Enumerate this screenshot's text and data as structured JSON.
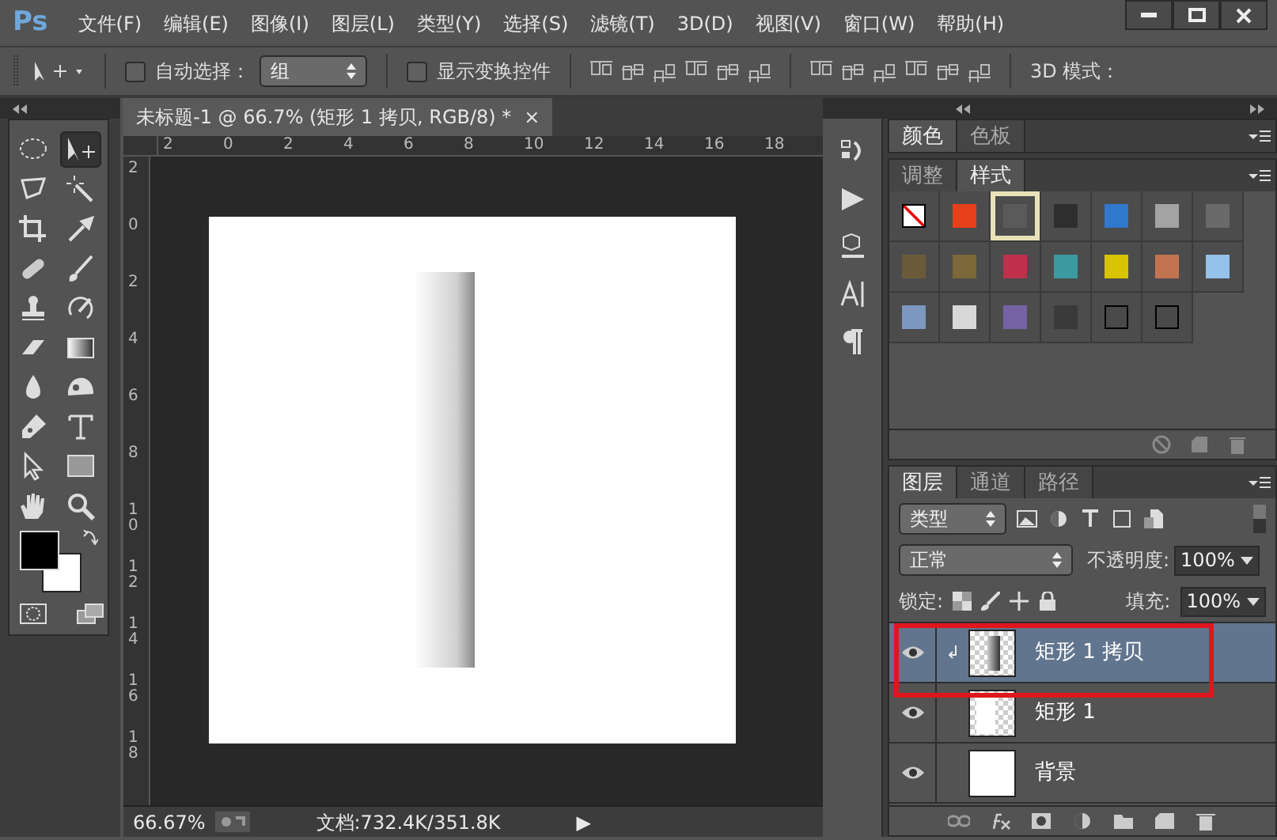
{
  "app": {
    "logo": "Ps"
  },
  "menu": [
    "文件(F)",
    "编辑(E)",
    "图像(I)",
    "图层(L)",
    "类型(Y)",
    "选择(S)",
    "滤镜(T)",
    "3D(D)",
    "视图(V)",
    "窗口(W)",
    "帮助(H)"
  ],
  "options_bar": {
    "auto_select": {
      "label": "自动选择：",
      "checked": false
    },
    "auto_select_target": "组",
    "show_transform": {
      "label": "显示变换控件",
      "checked": false
    },
    "mode_label": "3D 模式："
  },
  "toolbar": {
    "tools": [
      {
        "selected": false
      },
      {
        "selected": true
      },
      {
        "selected": false
      },
      {
        "selected": false
      },
      {
        "selected": false
      },
      {
        "selected": false
      },
      {
        "selected": false
      },
      {
        "selected": false
      },
      {
        "selected": false
      },
      {
        "selected": false
      },
      {
        "selected": false
      },
      {
        "selected": false
      },
      {
        "selected": false
      },
      {
        "selected": false
      },
      {
        "selected": false
      },
      {
        "selected": false
      },
      {
        "selected": false
      },
      {
        "selected": false
      },
      {
        "selected": false
      },
      {
        "selected": false
      }
    ]
  },
  "document_tab": {
    "title": "未标题-1 @ 66.7% (矩形 1 拷贝, RGB/8) *",
    "close": "×"
  },
  "rulers": {
    "horizontal": [
      "2",
      "0",
      "2",
      "4",
      "6",
      "8",
      "10",
      "12",
      "14",
      "16",
      "18"
    ],
    "vertical": [
      "2",
      "0",
      "2",
      "4",
      "6",
      "8",
      "10",
      "12",
      "14",
      "16",
      "18"
    ]
  },
  "status_bar": {
    "zoom": "66.67%",
    "doc_info": "文档:732.4K/351.8K",
    "menu_arrow": "▶"
  },
  "color_panel": {
    "tabs": [
      {
        "label": "颜色",
        "selected": true
      },
      {
        "label": "色板",
        "selected": false
      }
    ]
  },
  "styles_panel": {
    "tabs": [
      {
        "label": "调整",
        "selected": false
      },
      {
        "label": "样式",
        "selected": true
      }
    ],
    "swatches": [
      {
        "kind": "none",
        "color": "#ffffff",
        "selected": false
      },
      {
        "kind": "fill",
        "color": "#e8401a",
        "selected": false
      },
      {
        "kind": "fill",
        "color": "#5a5a5a",
        "selected": true
      },
      {
        "kind": "fill",
        "color": "#2e2e2e",
        "selected": false
      },
      {
        "kind": "fill",
        "color": "#2f78cc",
        "selected": false
      },
      {
        "kind": "fill",
        "color": "#a3a3a3",
        "selected": false
      },
      {
        "kind": "fill",
        "color": "#6a6a6a",
        "selected": false
      },
      {
        "kind": "fill",
        "color": "#6b5a3a",
        "selected": false
      },
      {
        "kind": "fill",
        "color": "#7c6838",
        "selected": false
      },
      {
        "kind": "fill",
        "color": "#c0304c",
        "selected": false
      },
      {
        "kind": "fill",
        "color": "#3a9aa0",
        "selected": false
      },
      {
        "kind": "fill",
        "color": "#d8c400",
        "selected": false
      },
      {
        "kind": "fill",
        "color": "#c27452",
        "selected": false
      },
      {
        "kind": "fill",
        "color": "#94c2ea",
        "selected": false
      },
      {
        "kind": "fill",
        "color": "#7c98c0",
        "selected": false
      },
      {
        "kind": "fill",
        "color": "#d8d8d8",
        "selected": false
      },
      {
        "kind": "fill",
        "color": "#7462a4",
        "selected": false
      },
      {
        "kind": "fill",
        "color": "#3a3a3a",
        "selected": false
      },
      {
        "kind": "outline",
        "color": "#4a4a4a",
        "selected": false
      },
      {
        "kind": "outline",
        "color": "#4a4a4a",
        "selected": false
      }
    ]
  },
  "layers_panel": {
    "tabs": [
      {
        "label": "图层",
        "selected": true
      },
      {
        "label": "通道",
        "selected": false
      },
      {
        "label": "路径",
        "selected": false
      }
    ],
    "filter": "类型",
    "blend_mode": "正常",
    "opacity_label": "不透明度:",
    "opacity": "100%",
    "lock_label": "锁定:",
    "fill_label": "填充:",
    "fill": "100%",
    "layers": [
      {
        "name": "矩形 1 拷贝",
        "kind": "gradient",
        "visible": true,
        "selected": true,
        "clipped": true,
        "highlighted": true
      },
      {
        "name": "矩形 1",
        "kind": "shape",
        "visible": true,
        "selected": false,
        "clipped": false,
        "highlighted": false
      },
      {
        "name": "背景",
        "kind": "white",
        "visible": true,
        "selected": false,
        "clipped": false,
        "highlighted": false
      }
    ]
  }
}
